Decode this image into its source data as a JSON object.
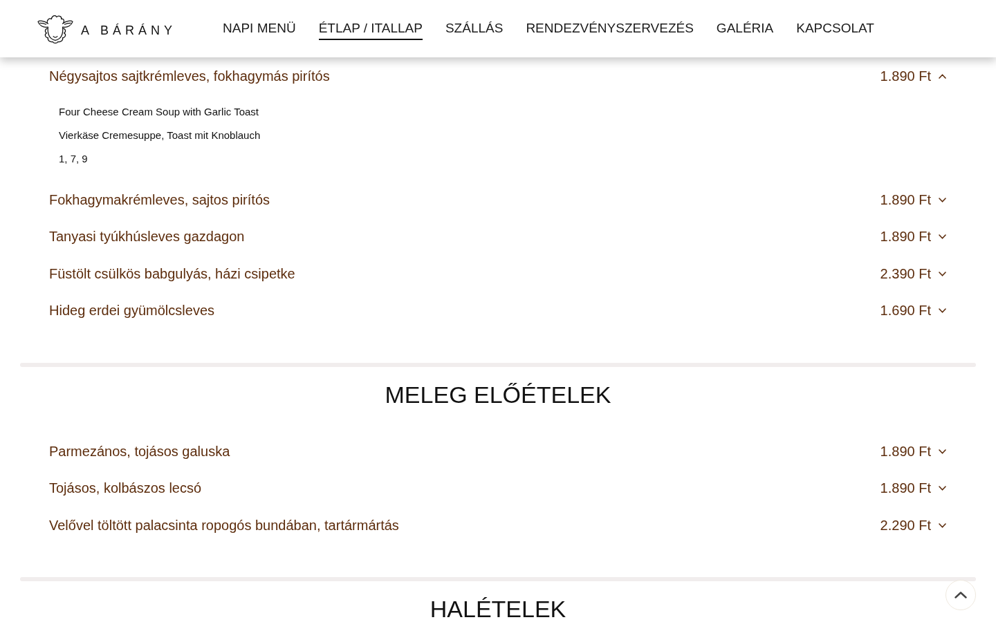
{
  "header": {
    "logo_text": "A BÁRÁNY",
    "nav": [
      {
        "label": "NAPI MENÜ",
        "selected": false
      },
      {
        "label": "ÉTLAP / ITALLAP",
        "selected": true
      },
      {
        "label": "SZÁLLÁS",
        "selected": false
      },
      {
        "label": "RENDEZVÉNYSZERVEZÉS",
        "selected": false
      },
      {
        "label": "GALÉRIA",
        "selected": false
      },
      {
        "label": "KAPCSOLAT",
        "selected": false
      }
    ]
  },
  "sections": [
    {
      "items": [
        {
          "name": "Négysajtos sajtkrémleves, fokhagymás pirítós",
          "price": "1.890 Ft",
          "expanded": true,
          "details": {
            "english": "Four Cheese Cream Soup with Garlic Toast",
            "german": "Vierkäse Cremesuppe, Toast mit Knoblauch",
            "allergens": "1, 7, 9"
          }
        },
        {
          "name": "Fokhagymakrémleves, sajtos pirítós",
          "price": "1.890 Ft",
          "expanded": false
        },
        {
          "name": "Tanyasi tyúkhúsleves gazdagon",
          "price": "1.890 Ft",
          "expanded": false
        },
        {
          "name": "Füstölt csülkös babgulyás, házi csipetke",
          "price": "2.390 Ft",
          "expanded": false
        },
        {
          "name": "Hideg erdei gyümölcsleves",
          "price": "1.690 Ft",
          "expanded": false
        }
      ]
    },
    {
      "title": "MELEG ELŐÉTELEK",
      "items": [
        {
          "name": "Parmezános, tojásos galuska",
          "price": "1.890 Ft",
          "expanded": false
        },
        {
          "name": "Tojásos, kolbászos lecsó",
          "price": "1.890 Ft",
          "expanded": false
        },
        {
          "name": "Velővel töltött palacsinta ropogós bundában, tartármártás",
          "price": "2.290 Ft",
          "expanded": false
        }
      ]
    },
    {
      "title": "HALÉTELEK"
    }
  ]
}
